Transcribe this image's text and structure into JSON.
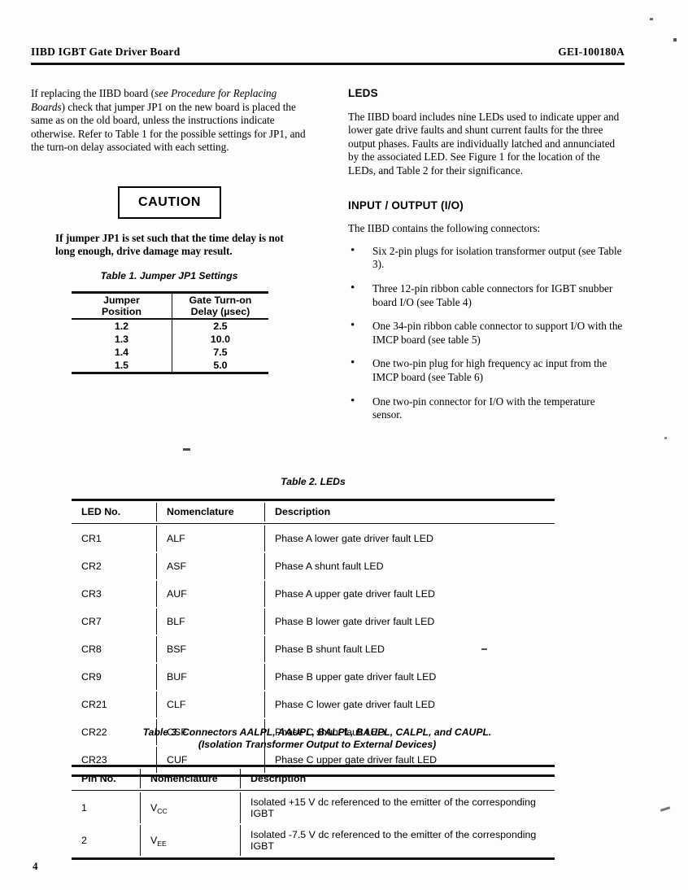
{
  "header": {
    "left_title": "IIBD IGBT Gate Driver Board",
    "right_doc_number": "GEI-100180A"
  },
  "left_column": {
    "paragraph_1_pre": "If replacing the IIBD board (",
    "paragraph_1_italic": "see Procedure for Replacing Boards",
    "paragraph_1_post": ") check that jumper JP1 on the new board is placed the same as on the old board, unless the instructions indicate otherwise. Refer to Table 1 for the possible settings for JP1, and the turn-on delay associated with each setting.",
    "caution_label": "CAUTION",
    "caution_text": "If jumper JP1 is set such that the time delay is not long enough, drive damage may result."
  },
  "right_column": {
    "leds_heading": "LEDS",
    "leds_paragraph": "The IIBD board includes nine LEDs used to indicate upper and lower gate drive faults and shunt current faults for the three output phases. Faults are individually latched and annunciated by the associated LED. See Figure 1 for the location of the LEDs, and Table 2 for their significance.",
    "io_heading": "INPUT / OUTPUT (I/O)",
    "io_paragraph": "The IIBD contains the following connectors:",
    "bullet_glyph": "•",
    "io_items": [
      "Six 2-pin plugs for isolation transformer output (see Table 3).",
      "Three 12-pin ribbon cable connectors for IGBT snubber board I/O (see Table 4)",
      "One 34-pin ribbon cable connector to support I/O with the IMCP board (see table 5)",
      "One two-pin plug for high frequency ac input from the IMCP board (see Table 6)",
      "One two-pin connector for I/O with the temperature sensor."
    ]
  },
  "table1": {
    "caption": "Table 1.  Jumper JP1 Settings",
    "headers": [
      "Jumper Position",
      "Gate Turn-on Delay (µsec)"
    ],
    "header_line1": [
      "Jumper",
      "Gate Turn-on"
    ],
    "header_line2": [
      "Position",
      "Delay (µsec)"
    ],
    "rows": [
      [
        "1.2",
        "2.5"
      ],
      [
        "1.3",
        "10.0"
      ],
      [
        "1.4",
        "7.5"
      ],
      [
        "1.5",
        "5.0"
      ]
    ]
  },
  "table2": {
    "caption": "Table 2.  LEDs",
    "headers": [
      "LED No.",
      "Nomenclature",
      "Description"
    ],
    "rows": [
      [
        "CR1",
        "ALF",
        "Phase A lower gate driver fault LED"
      ],
      [
        "CR2",
        "ASF",
        "Phase A shunt fault LED"
      ],
      [
        "CR3",
        "AUF",
        "Phase A upper gate driver fault LED"
      ],
      [
        "CR7",
        "BLF",
        "Phase B lower gate driver fault LED"
      ],
      [
        "CR8",
        "BSF",
        "Phase B shunt fault LED"
      ],
      [
        "CR9",
        "BUF",
        "Phase B upper gate driver fault LED"
      ],
      [
        "CR21",
        "CLF",
        "Phase C lower gate driver fault LED"
      ],
      [
        "CR22",
        "CSF",
        "Phase C shunt fault LED"
      ],
      [
        "CR23",
        "CUF",
        "Phase C upper gate driver fault LED"
      ]
    ]
  },
  "table3": {
    "caption_line1": "Table 3.  Connectors AALPL, AAUPL, BALPL, BAUPL, CALPL, and CAUPL.",
    "caption_line2": "(Isolation Transformer Output to External Devices)",
    "headers": [
      "Pin No.",
      "Nomenclature",
      "Description"
    ],
    "rows": [
      {
        "pin": "1",
        "nom_base": "V",
        "nom_sub": "CC",
        "description": "Isolated +15 V dc referenced to the emitter of the corresponding IGBT"
      },
      {
        "pin": "2",
        "nom_base": "V",
        "nom_sub": "EE",
        "description": "Isolated -7.5 V dc referenced to the emitter of the corresponding IGBT"
      }
    ]
  },
  "footer": {
    "page_number": "4"
  }
}
